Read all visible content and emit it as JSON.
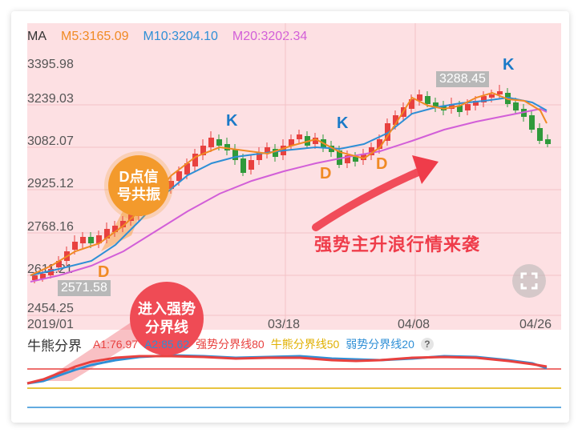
{
  "ma_legend": {
    "label": "MA",
    "m5": "M5:3165.09",
    "m10": "M10:3204.10",
    "m20": "M20:3202.34"
  },
  "y_axis": [
    "3395.98",
    "3239.03",
    "3082.07",
    "2925.12",
    "2768.16",
    "2611.21",
    "2454.25"
  ],
  "x_axis": [
    "2019/01",
    "03/18",
    "04/08",
    "04/26"
  ],
  "price_tags": {
    "high": "3288.45",
    "low": "2571.58"
  },
  "marks": {
    "k": "K",
    "d": "D"
  },
  "annotations": {
    "d_signal": "D点信号共振",
    "d_signal_line1": "D点信",
    "d_signal_line2": "号共振",
    "strong_zone_line1": "进入强势",
    "strong_zone_line2": "分界线",
    "trend": "强势主升浪行情来袭"
  },
  "indicator": {
    "title": "牛熊分界",
    "a1": "A1:76.97",
    "a2": "A2:85.62",
    "strong": "强势分界线80",
    "neutral": "牛熊分界线50",
    "weak": "弱势分界线20",
    "help": "?"
  },
  "colors": {
    "m5": "#f08a24",
    "m10": "#2e8fd6",
    "m20": "#d25fd8",
    "up": "#e8413f",
    "down": "#2f9a3b",
    "strong": "#e8413f",
    "neutral": "#e0b000",
    "weak": "#2e8fd6",
    "chart_bg": "#fde0e3"
  },
  "icons": {
    "fullscreen": "fullscreen-icon"
  }
}
